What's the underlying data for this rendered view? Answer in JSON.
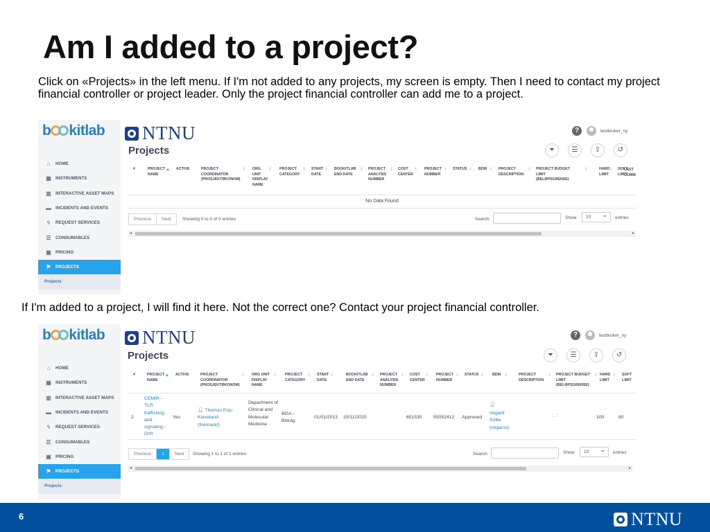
{
  "slide": {
    "title": "Am I added to a project?",
    "intro": "Click on «Projects» in the left menu. If I'm not added to any projects, my screen is empty. Then I need to contact my project financial controller or project leader. Only the project financial controller can add me to a project.",
    "mid": "If I'm added to a project, I will find it here. Not the correct one? Contact your project financial controller.",
    "page_number": "6",
    "footer_logo": "NTNU"
  },
  "app": {
    "logo": "b  kitlab",
    "ntnu_text": "NTNU",
    "help_icon": "?",
    "username": "testbruker_ny",
    "page_title": "Projects",
    "nav": [
      {
        "label": "HOME",
        "icon": "⌂"
      },
      {
        "label": "INSTRUMENTS",
        "icon": "▦"
      },
      {
        "label": "INTERACTIVE ASSET MAPS",
        "icon": "▥"
      },
      {
        "label": "INCIDENTS AND EVENTS",
        "icon": "▬"
      },
      {
        "label": "REQUEST SERVICES",
        "icon": "ϟ"
      },
      {
        "label": "CONSUMABLES",
        "icon": "☰"
      },
      {
        "label": "PRICING",
        "icon": "▣"
      },
      {
        "label": "PROJECTS",
        "icon": "⚑"
      }
    ],
    "nav_sub": "Projects",
    "tools": [
      "⏷",
      "☰",
      "⇪",
      "↺"
    ]
  },
  "table1": {
    "headers": [
      "#",
      "PROJECT NAME",
      "ACTIVE",
      "PROJECT COORDINATOR (PROSJEKTØKONOM)",
      "ORG UNIT DISPLAY NAME",
      "PROJECT CATEGORY",
      "START DATE",
      "BOOKITLAB END DATE",
      "PROJECT ANALYSIS NUMBER",
      "COST CENTER",
      "PROJECT NUMBER",
      "STATUS",
      "BDM",
      "PROJECT DESCRIPTION",
      "PROJECT BUDGET LIMIT (BELØPSGRENSE)",
      "HARD LIMIT",
      "SOFT LIMIT",
      "LAST COMM"
    ],
    "empty": "No Data Found",
    "prev": "Previous",
    "next": "Next",
    "info": "Showing 0 to 0 of 0 entries",
    "search_label": "Search:",
    "show_label": "Show",
    "show_value": "10",
    "entries_label": "entries"
  },
  "table2": {
    "headers": [
      "#",
      "PROJECT NAME",
      "ACTIVE",
      "PROJECT COORDINATOR (PROSJEKTØKONOM)",
      "ORG UNIT DISPLAY NAME",
      "PROJECT CATEGORY",
      "START DATE",
      "BOOKITLAB END DATE",
      "PROJECT ANALYSIS NUMBER",
      "COST CENTER",
      "PROJECT NUMBER",
      "STATUS",
      "BDM",
      "PROJECT DESCRIPTION",
      "PROJECT BUDGET LIMIT (BELØPSGRENSE)",
      "HARD LIMIT",
      "SOFT LIMIT"
    ],
    "row": {
      "num": "2",
      "name": "CEMIR - TLR trafficking and signaling - Drift",
      "active": "Yes",
      "coordinator": "Thomas Evju Klaveland (thomaskl)",
      "org_unit": "Department of Clinical and Molecular Medicine",
      "category": "BOA - Bidrag",
      "start": "01/01/2013",
      "end": "15/11/2020",
      "cost_center": "651530",
      "project_number": "50052412",
      "status": "Approved",
      "bdm": "Vegard Sollie (vegarso)",
      "budget": "'...'",
      "hard_limit": "100",
      "soft_limit": "80"
    },
    "prev": "Previous",
    "page": "1",
    "next": "Next",
    "info": "Showing 1 to 1 of 1 entries",
    "search_label": "Search:",
    "show_label": "Show",
    "show_value": "10",
    "entries_label": "entries"
  }
}
